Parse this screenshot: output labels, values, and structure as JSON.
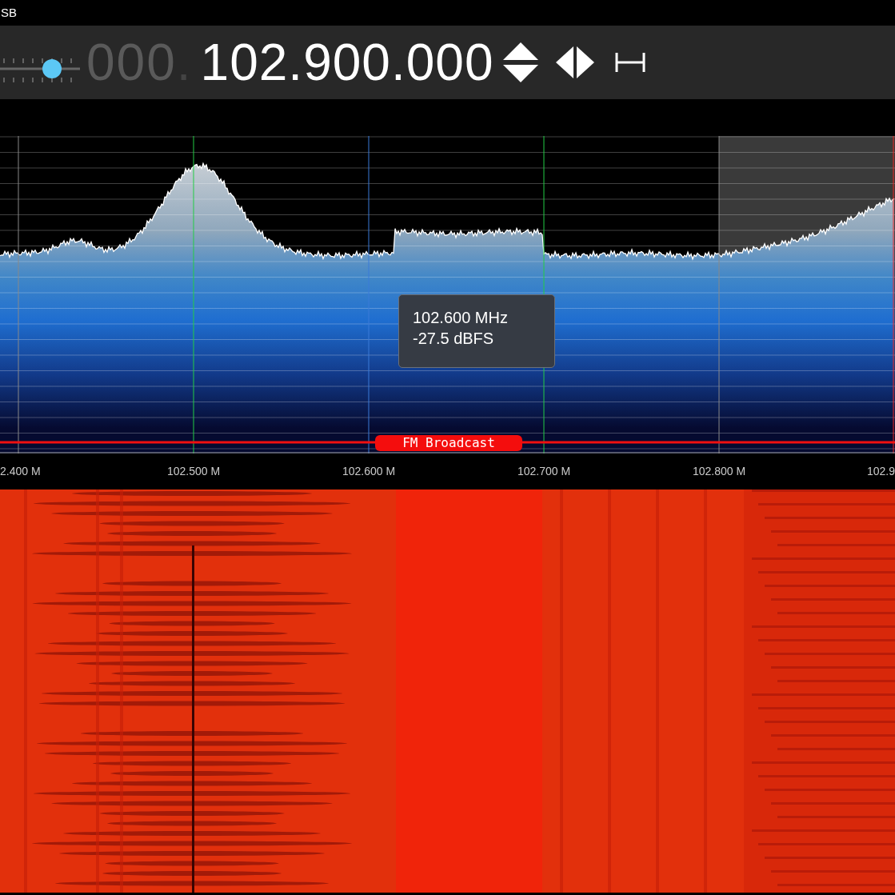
{
  "header": {
    "mode_label": "SB"
  },
  "tuner": {
    "zoom_slider": {
      "level": 0.65
    },
    "frequency_dim": "000",
    "frequency_dim_separator": ".",
    "frequency": "102.900.000"
  },
  "spectrum": {
    "axis_labels": [
      "2.400 M",
      "102.500 M",
      "102.600 M",
      "102.700 M",
      "102.800 M",
      "102.9"
    ],
    "tooltip": {
      "lines": [
        "102.600 MHz",
        "-27.5 dBFS"
      ]
    },
    "bookmark": {
      "label": "FM Broadcast"
    }
  }
}
